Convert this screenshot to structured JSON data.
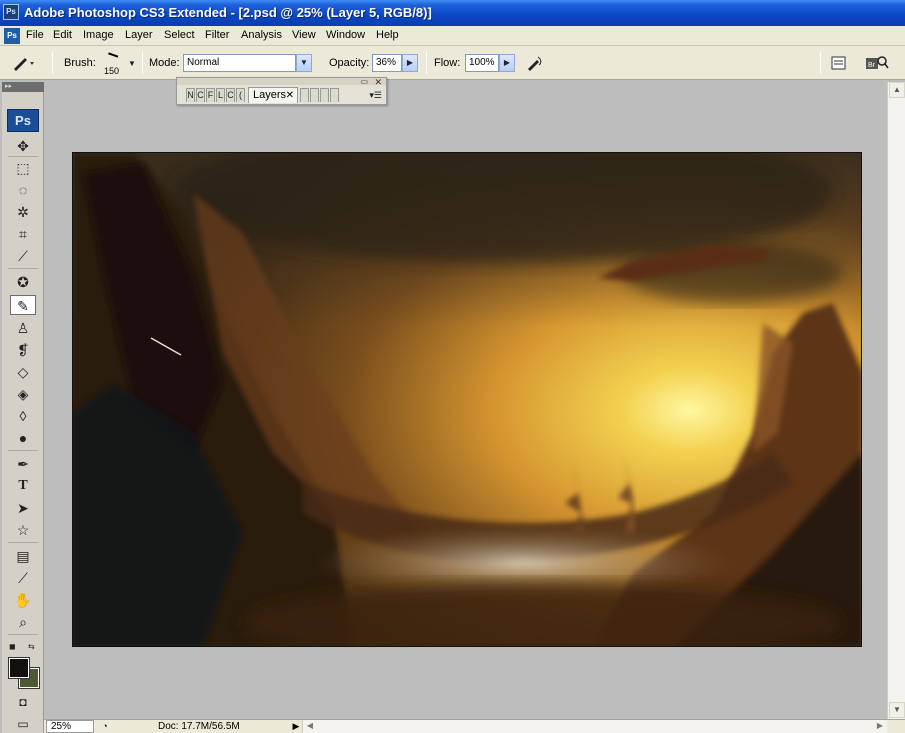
{
  "window": {
    "title": "Adobe Photoshop CS3 Extended - [2.psd @ 25% (Layer 5, RGB/8)]",
    "icon": "Ps"
  },
  "menu": {
    "app_icon": "Ps",
    "items": [
      "File",
      "Edit",
      "Image",
      "Layer",
      "Select",
      "Filter",
      "Analysis",
      "View",
      "Window",
      "Help"
    ]
  },
  "options": {
    "brush_label": "Brush:",
    "brush_size": "150",
    "mode_label": "Mode:",
    "mode_value": "Normal",
    "opacity_label": "Opacity:",
    "opacity_value": "36%",
    "flow_label": "Flow:",
    "flow_value": "100%"
  },
  "palette": {
    "active_tab": "Layers",
    "mini_tabs": [
      "N",
      "C",
      "F",
      "L",
      "C",
      "(",
      "S"
    ]
  },
  "toolbox": {
    "logo": "Ps",
    "tools": [
      {
        "name": "move-tool",
        "glyph": "✥"
      },
      {
        "name": "marquee-tool",
        "glyph": "⬚"
      },
      {
        "name": "lasso-tool",
        "glyph": "◌"
      },
      {
        "name": "magic-wand-tool",
        "glyph": "✲"
      },
      {
        "name": "crop-tool",
        "glyph": "⌗"
      },
      {
        "name": "eyedropper-slice-tool",
        "glyph": "⟋"
      },
      {
        "name": "healing-brush-tool",
        "glyph": "✪"
      },
      {
        "name": "brush-tool",
        "glyph": "✎"
      },
      {
        "name": "clone-stamp-tool",
        "glyph": "♙"
      },
      {
        "name": "history-brush-tool",
        "glyph": "❡"
      },
      {
        "name": "eraser-tool",
        "glyph": "◇"
      },
      {
        "name": "paint-bucket-tool",
        "glyph": "◈"
      },
      {
        "name": "blur-tool",
        "glyph": "◊"
      },
      {
        "name": "dodge-tool",
        "glyph": "●"
      },
      {
        "name": "pen-tool",
        "glyph": "✒"
      },
      {
        "name": "type-tool",
        "glyph": "T"
      },
      {
        "name": "path-selection-tool",
        "glyph": "➤"
      },
      {
        "name": "shape-tool",
        "glyph": "☆"
      },
      {
        "name": "notes-tool",
        "glyph": "▤"
      },
      {
        "name": "eyedropper-tool",
        "glyph": "⟋"
      },
      {
        "name": "hand-tool",
        "glyph": "✋"
      },
      {
        "name": "zoom-tool",
        "glyph": "⌕"
      }
    ],
    "foreground_color": "#14100c",
    "background_color": "#4e5a33"
  },
  "status": {
    "zoom": "25%",
    "doc": "Doc: 17.7M/56.5M"
  }
}
